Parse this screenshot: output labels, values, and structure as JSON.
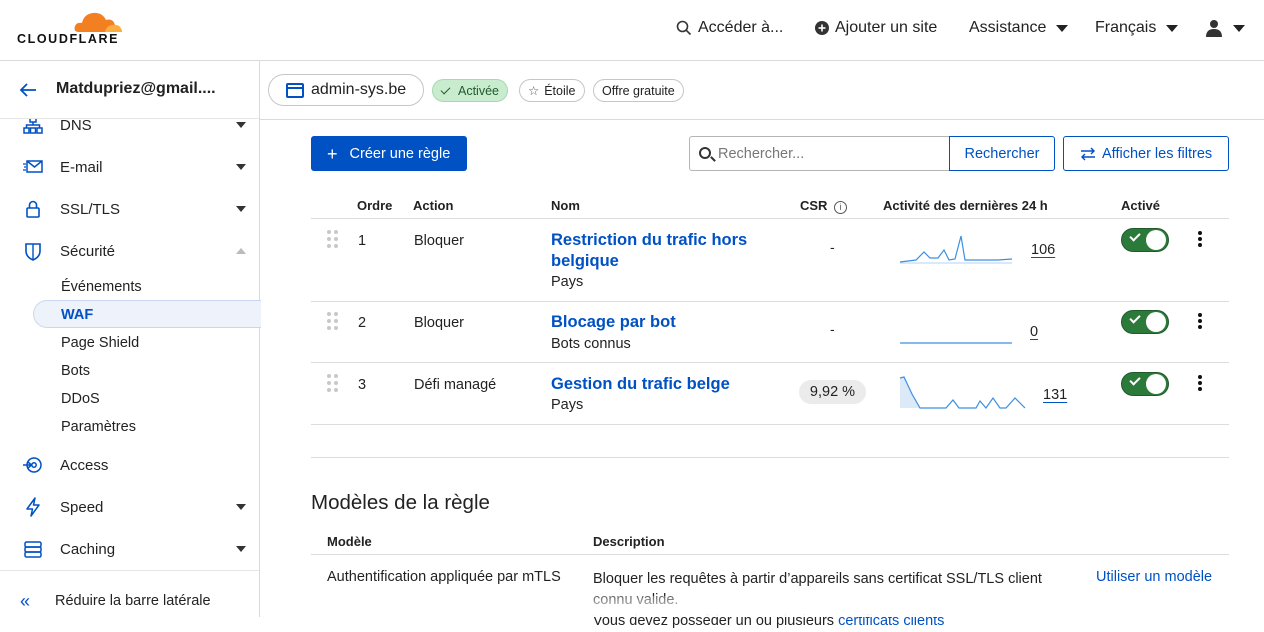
{
  "brand": {
    "logo_text": "CLOUDFLARE",
    "logo_icon": "cloud-logo-icon",
    "accent": "#F38020"
  },
  "topnav": {
    "goto_label": "Accéder à...",
    "add_site_label": "Ajouter un site",
    "support_label": "Assistance",
    "language_label": "Français",
    "user_icon": "user-icon"
  },
  "sidebar": {
    "account_name": "Matdupriez@gmail....",
    "items": [
      {
        "label": "DNS",
        "icon": "dns-icon"
      },
      {
        "label": "E-mail",
        "icon": "email-icon"
      },
      {
        "label": "SSL/TLS",
        "icon": "lock-icon"
      },
      {
        "label": "Sécurité",
        "icon": "shield-icon"
      },
      {
        "label": "Access",
        "icon": "access-icon"
      },
      {
        "label": "Speed",
        "icon": "lightning-icon"
      },
      {
        "label": "Caching",
        "icon": "caching-icon"
      }
    ],
    "security_sub": [
      "Événements",
      "WAF",
      "Page Shield",
      "Bots",
      "DDoS",
      "Paramètres"
    ],
    "active_sub": "WAF",
    "collapse_label": "Réduire la barre latérale"
  },
  "zone": {
    "domain": "admin-sys.be",
    "status": "Activée",
    "star_label": "Étoile",
    "plan": "Offre gratuite"
  },
  "toolbar": {
    "create_label": "Créer une règle",
    "search_placeholder": "Rechercher...",
    "search_button": "Rechercher",
    "filters_button": "Afficher les filtres"
  },
  "rules_table": {
    "headers": {
      "order": "Ordre",
      "action": "Action",
      "name": "Nom",
      "csr": "CSR",
      "activity": "Activité des dernières 24 h",
      "enabled": "Activé"
    },
    "rows": [
      {
        "order": "1",
        "action": "Bloquer",
        "name_line1": "Restriction du trafic hors",
        "name_line2": "belgique",
        "subtitle": "Pays",
        "csr": "-",
        "count": "106",
        "enabled": true
      },
      {
        "order": "2",
        "action": "Bloquer",
        "name_line1": "Blocage par bot",
        "name_line2": "",
        "subtitle": "Bots connus",
        "csr": "-",
        "count": "0",
        "enabled": true
      },
      {
        "order": "3",
        "action": "Défi managé",
        "name_line1": "Gestion du trafic belge",
        "name_line2": "",
        "subtitle": "Pays",
        "csr": "9,92 %",
        "count": "131",
        "enabled": true
      }
    ]
  },
  "templates": {
    "title": "Modèles de la règle",
    "headers": {
      "model": "Modèle",
      "description": "Description"
    },
    "rows": [
      {
        "model": "Authentification appliquée par mTLS",
        "description_line1": "Bloquer les requêtes à partir d’appareils sans certificat SSL/TLS client",
        "description_line2": "connu valide.",
        "description_line3_prefix": "Vous devez posséder un ou plusieurs",
        "description_line3_link": "certificats clients",
        "action": "Utiliser un modèle"
      }
    ]
  }
}
